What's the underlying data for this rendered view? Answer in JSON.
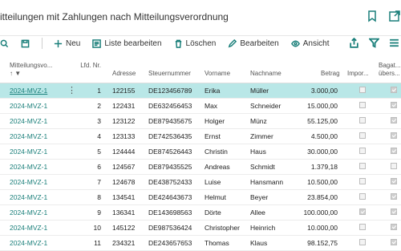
{
  "header": {
    "title": "itteilungen mit Zahlungen nach Mitteilungsverordnung"
  },
  "actions": {
    "neu": "Neu",
    "liste_bearbeiten": "Liste bearbeiten",
    "loeschen": "Löschen",
    "bearbeiten": "Bearbeiten",
    "ansicht": "Ansicht"
  },
  "columns": {
    "mitteilungsvorgang": "Mitteilungsvo...",
    "lfd_nr": "Lfd. Nr.",
    "adresse": "Adresse",
    "steuernummer": "Steuernummer",
    "vorname": "Vorname",
    "nachname": "Nachname",
    "betrag": "Betrag",
    "import": "Impor...",
    "bagatell_line1": "Bagat...",
    "bagatell_line2": "übers..."
  },
  "rows": [
    {
      "vorgang": "2024-MVZ-1",
      "nr": "1",
      "adresse": "122155",
      "steuer": "DE123456789",
      "vorname": "Erika",
      "nachname": "Müller",
      "betrag": "3.000,00",
      "imp": false,
      "bag": true
    },
    {
      "vorgang": "2024-MVZ-1",
      "nr": "2",
      "adresse": "122431",
      "steuer": "DE632456453",
      "vorname": "Max",
      "nachname": "Schneider",
      "betrag": "15.000,00",
      "imp": false,
      "bag": true
    },
    {
      "vorgang": "2024-MVZ-1",
      "nr": "3",
      "adresse": "123122",
      "steuer": "DE879435675",
      "vorname": "Holger",
      "nachname": "Münz",
      "betrag": "55.125,00",
      "imp": false,
      "bag": true
    },
    {
      "vorgang": "2024-MVZ-1",
      "nr": "4",
      "adresse": "123133",
      "steuer": "DE742536435",
      "vorname": "Ernst",
      "nachname": "Zimmer",
      "betrag": "4.500,00",
      "imp": false,
      "bag": true
    },
    {
      "vorgang": "2024-MVZ-1",
      "nr": "5",
      "adresse": "124444",
      "steuer": "DE874526443",
      "vorname": "Christin",
      "nachname": "Haus",
      "betrag": "30.000,00",
      "imp": false,
      "bag": true
    },
    {
      "vorgang": "2024-MVZ-1",
      "nr": "6",
      "adresse": "124567",
      "steuer": "DE879435525",
      "vorname": "Andreas",
      "nachname": "Schmidt",
      "betrag": "1.379,18",
      "imp": false,
      "bag": false
    },
    {
      "vorgang": "2024-MVZ-1",
      "nr": "7",
      "adresse": "124678",
      "steuer": "DE438752433",
      "vorname": "Luise",
      "nachname": "Hansmann",
      "betrag": "10.500,00",
      "imp": false,
      "bag": true
    },
    {
      "vorgang": "2024-MVZ-1",
      "nr": "8",
      "adresse": "134541",
      "steuer": "DE424643673",
      "vorname": "Helmut",
      "nachname": "Beyer",
      "betrag": "23.854,00",
      "imp": false,
      "bag": true
    },
    {
      "vorgang": "2024-MVZ-1",
      "nr": "9",
      "adresse": "136341",
      "steuer": "DE143698563",
      "vorname": "Dörte",
      "nachname": "Allee",
      "betrag": "100.000,00",
      "imp": true,
      "bag": true
    },
    {
      "vorgang": "2024-MVZ-1",
      "nr": "10",
      "adresse": "145122",
      "steuer": "DE987536424",
      "vorname": "Christopher",
      "nachname": "Heinrich",
      "betrag": "10.000,00",
      "imp": false,
      "bag": true
    },
    {
      "vorgang": "2024-MVZ-1",
      "nr": "11",
      "adresse": "234321",
      "steuer": "DE243657653",
      "vorname": "Thomas",
      "nachname": "Klaus",
      "betrag": "98.152,75",
      "imp": false,
      "bag": true
    }
  ]
}
